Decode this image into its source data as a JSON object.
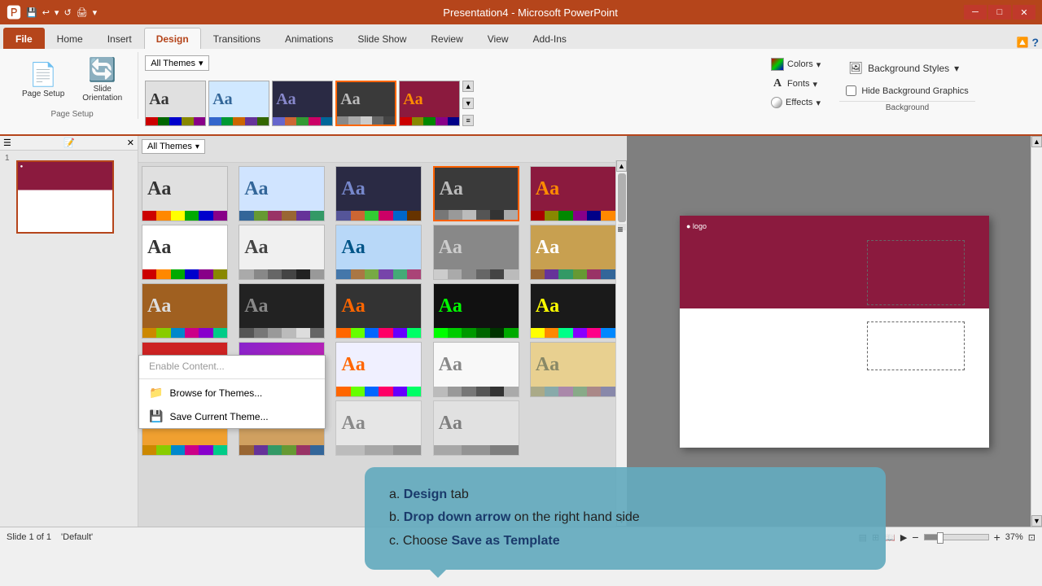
{
  "titlebar": {
    "title": "Presentation4 - Microsoft PowerPoint",
    "min_label": "─",
    "max_label": "□",
    "close_label": "✕"
  },
  "quickaccess": {
    "buttons": [
      "🅿",
      "💾",
      "↩",
      "▾",
      "🔄",
      "🖨",
      "▾"
    ]
  },
  "tabs": [
    {
      "label": "File",
      "id": "file",
      "active": false
    },
    {
      "label": "Home",
      "id": "home",
      "active": false
    },
    {
      "label": "Insert",
      "id": "insert",
      "active": false
    },
    {
      "label": "Design",
      "id": "design",
      "active": true
    },
    {
      "label": "Transitions",
      "id": "transitions",
      "active": false
    },
    {
      "label": "Animations",
      "id": "animations",
      "active": false
    },
    {
      "label": "Slide Show",
      "id": "slideshow",
      "active": false
    },
    {
      "label": "Review",
      "id": "review",
      "active": false
    },
    {
      "label": "View",
      "id": "view",
      "active": false
    },
    {
      "label": "Add-Ins",
      "id": "addins",
      "active": false
    }
  ],
  "ribbon": {
    "page_setup_group": "Page Setup",
    "page_setup_btn": "Page Setup",
    "slide_orientation_btn": "Slide\nOrientation",
    "themes_dropdown": "All Themes",
    "themes_dropdown_arrow": "▾",
    "colors_btn": "Colors",
    "fonts_btn": "Fonts",
    "effects_btn": "Effects",
    "bg_styles_btn": "Background Styles",
    "hide_bg_label": "Hide Background Graphics",
    "background_group": "Background"
  },
  "themes": [
    {
      "bg": "#e8e8e8",
      "text_color": "#333",
      "row": 0
    },
    {
      "bg": "#d0e8ff",
      "text_color": "#336",
      "row": 0
    },
    {
      "bg": "#2a2a2a",
      "text_color": "#88c",
      "row": 0
    },
    {
      "bg": "#3a3a3a",
      "text_color": "#bbb",
      "row": 0
    },
    {
      "bg": "#8b1a3e",
      "text_color": "#ff8c00",
      "row": 0
    },
    {
      "bg": "#ffffff",
      "text_color": "#333",
      "row": 1
    },
    {
      "bg": "#f0f0f0",
      "text_color": "#555",
      "row": 1
    },
    {
      "bg": "#b0e0ff",
      "text_color": "#005",
      "row": 1
    },
    {
      "bg": "#888",
      "text_color": "#ccc",
      "row": 1
    },
    {
      "bg": "#c8a050",
      "text_color": "#fff",
      "row": 1
    },
    {
      "bg": "#a06020",
      "text_color": "#ddd",
      "row": 2
    },
    {
      "bg": "#222",
      "text_color": "#888",
      "row": 2
    },
    {
      "bg": "#333",
      "text_color": "#f60",
      "row": 2
    },
    {
      "bg": "#111",
      "text_color": "#0f0",
      "row": 2
    },
    {
      "bg": "#1a1a1a",
      "text_color": "#ff0",
      "row": 2
    },
    {
      "bg": "#cc2222",
      "text_color": "#fff",
      "row": 3
    },
    {
      "bg": "#8822cc",
      "text_color": "#ff88aa",
      "row": 3
    },
    {
      "bg": "#f0f0ff",
      "text_color": "#f60",
      "row": 3
    },
    {
      "bg": "#f8f8f8",
      "text_color": "#888",
      "row": 3
    },
    {
      "bg": "#e8d090",
      "text_color": "#888",
      "row": 3
    },
    {
      "bg": "#f0a030",
      "text_color": "#333",
      "row": 4
    },
    {
      "bg": "#d0a060",
      "text_color": "#333",
      "row": 4
    }
  ],
  "slide_panel": {
    "slide_number": "1"
  },
  "status_bar": {
    "slide_count": "Slide 1 of 1",
    "theme": "'Default'",
    "zoom": "37%",
    "zoom_minus": "−",
    "zoom_plus": "+"
  },
  "tooltip": {
    "line_a_prefix": "a. ",
    "line_a_highlight": "Design",
    "line_a_suffix": " tab",
    "line_b_prefix": "b. ",
    "line_b_highlight": "Drop down arrow",
    "line_b_suffix": " on the right hand side",
    "line_c_prefix": "c. Choose ",
    "line_c_highlight": "Save as Template"
  },
  "dropdown": {
    "item1": "Enable Content...",
    "item2": "Browse for Themes...",
    "item3": "Save Current Theme..."
  }
}
